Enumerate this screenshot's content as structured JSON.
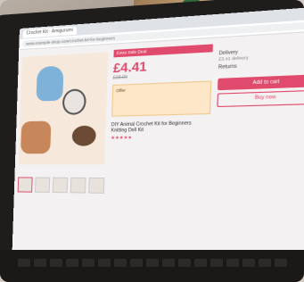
{
  "browser": {
    "tab_title": "Crochet Kit · Amigurumi",
    "url": "www.example-shop.com/crochet-kit-for-beginners"
  },
  "product": {
    "sale_banner": "Extra Sale Deal",
    "price": "£4.41",
    "old_price": "£18.00",
    "offer_title": "Offer",
    "title_line1": "DIY Animal Crochet Kit for Beginners",
    "title_line2": "Knitting Doll Kit",
    "rating": "★★★★★"
  },
  "sidebar": {
    "shipping_label": "Delivery",
    "shipping_text": "£3.41 delivery",
    "returns_label": "Returns",
    "add_to_cart": "Add to cart",
    "buy_now": "Buy now"
  },
  "colors": {
    "accent": "#e04a6c"
  }
}
